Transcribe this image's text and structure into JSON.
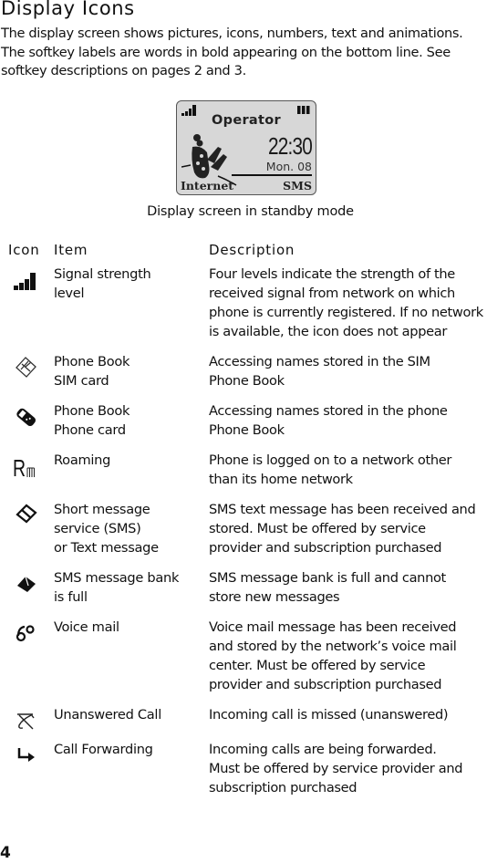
{
  "page": {
    "title": "Display Icons",
    "intro": "The display screen shows pictures, icons, numbers, text and animations. The softkey labels are words in bold appearing on the bottom line. See softkey descriptions on pages 2 and 3.",
    "page_number": "4"
  },
  "standby_screen": {
    "operator": "Operator",
    "time": "22:30",
    "date": "Mon. 08",
    "softkey_left": "Internet",
    "softkey_right": "SMS",
    "caption": "Display screen in standby mode",
    "icons": [
      "signal-strength-icon",
      "battery-icon",
      "wallpaper-animation"
    ],
    "background_color": "#d7d7d7"
  },
  "table": {
    "headers": {
      "icon": "Icon",
      "item": "Item",
      "description": "Description"
    },
    "rows": [
      {
        "icon": "signal-strength-icon",
        "item": "Signal strength\nlevel",
        "description": "Four levels indicate the strength of the\nreceived signal from network on which\nphone is currently registered. If no network\nis available, the icon does not appear"
      },
      {
        "icon": "sim-card-phonebook-icon",
        "item": "Phone Book\nSIM card",
        "description": "Accessing names stored in the SIM\nPhone Book"
      },
      {
        "icon": "phone-phonebook-icon",
        "item": "Phone Book\nPhone card",
        "description": "Accessing names stored in the phone\nPhone Book"
      },
      {
        "icon": "roaming-icon",
        "item": "Roaming",
        "description": "Phone is logged on to a network other\nthan its home network"
      },
      {
        "icon": "sms-envelope-icon",
        "item": "Short message\nservice (SMS)\nor Text message",
        "description": "SMS text message has been received and\nstored. Must be offered by service\nprovider and subscription purchased"
      },
      {
        "icon": "sms-full-icon",
        "item": "SMS message bank\nis full",
        "description": "SMS message bank is full and cannot\nstore new messages"
      },
      {
        "icon": "voice-mail-icon",
        "item": "Voice mail",
        "description": "Voice mail message has been received\nand stored by the network’s voice mail\ncenter. Must be offered by service\nprovider and subscription purchased"
      },
      {
        "icon": "missed-call-icon",
        "item": "Unanswered Call",
        "description": "Incoming call is missed (unanswered)"
      },
      {
        "icon": "call-forwarding-icon",
        "item": "Call Forwarding",
        "description": "Incoming calls are being forwarded.\nMust be offered by service provider and\nsubscription purchased"
      }
    ]
  }
}
